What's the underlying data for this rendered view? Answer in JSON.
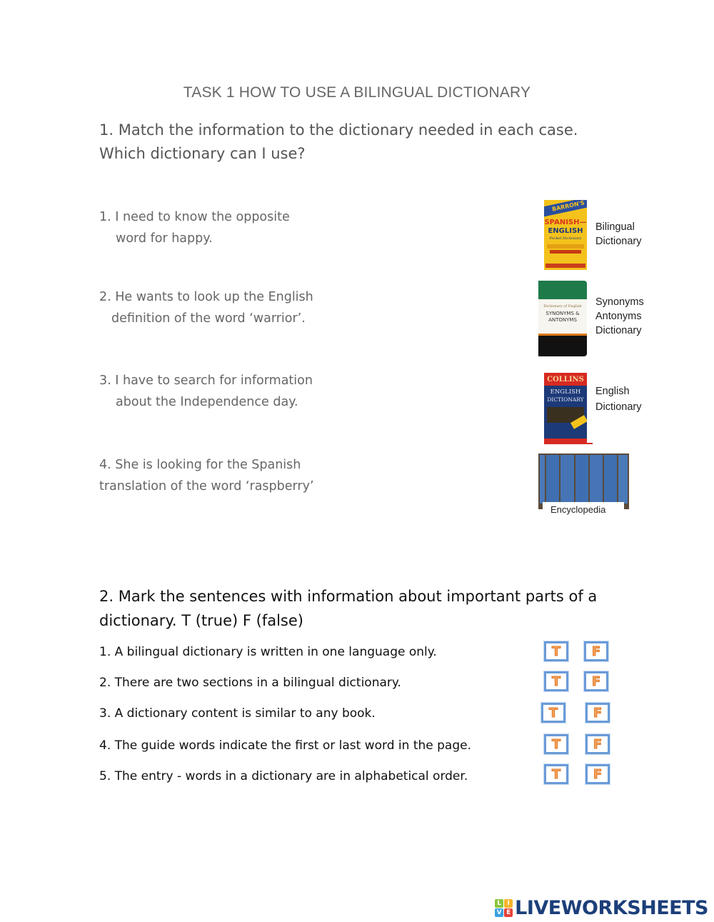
{
  "title": "TASK 1 HOW TO USE A BILINGUAL DICTIONARY",
  "section1": {
    "heading_line1": "1. Match the information to the dictionary needed in each case.",
    "heading_line2": "Which dictionary can I use?",
    "items": [
      {
        "line1": "1. I need to know the opposite",
        "line2": "word for happy."
      },
      {
        "line1": "2. He wants to look up the English",
        "line2": "definition of the word ‘warrior’."
      },
      {
        "line1": "3. I have to search for information",
        "line2": "about the Independence day."
      },
      {
        "line1": "4. She is looking for the Spanish",
        "line2": "translation of the word ‘raspberry’"
      }
    ],
    "dictionaries": [
      {
        "label_line1": "Bilingual",
        "label_line2": "Dictionary",
        "cover_top": "BARRON'S",
        "cover_mid1": "SPANISH—",
        "cover_mid2": "ENGLISH",
        "cover_sub": "Pocket Dictionary"
      },
      {
        "label_line1": "Synonyms",
        "label_line2": "Antonyms",
        "label_line3": "Dictionary",
        "cover_mid1": "SYNONYMS &",
        "cover_mid2": "ANTONYMS",
        "cover_sub": "Dictionary of English"
      },
      {
        "label_line1": "English",
        "label_line2": "Dictionary",
        "cover_top": "COLLINS",
        "cover_mid1": "ENGLISH",
        "cover_mid2": "DICTIONARY"
      },
      {
        "label_line1": "Encyclopedia"
      }
    ]
  },
  "section2": {
    "heading_line1": "2. Mark the sentences with information about important parts of a",
    "heading_line2": "dictionary. T (true) F (false)",
    "true_label": "T",
    "false_label": "F",
    "statements": [
      "1. A bilingual dictionary is written in one language only.",
      "2. There are two sections in a bilingual dictionary.",
      "3. A dictionary content is similar to any book.",
      "4. The guide words indicate the first or last word in the page.",
      "5. The entry - words in a dictionary are in alphabetical order."
    ]
  },
  "footer": {
    "logo_letters": [
      "L",
      "I",
      "V",
      "E"
    ],
    "logo_text": "LIVEWORKSHEETS"
  },
  "colors": {
    "tf_border": "#6a9bd8",
    "tf_letter": "#f5a25a",
    "logo_blue": "#1c3f7a"
  }
}
